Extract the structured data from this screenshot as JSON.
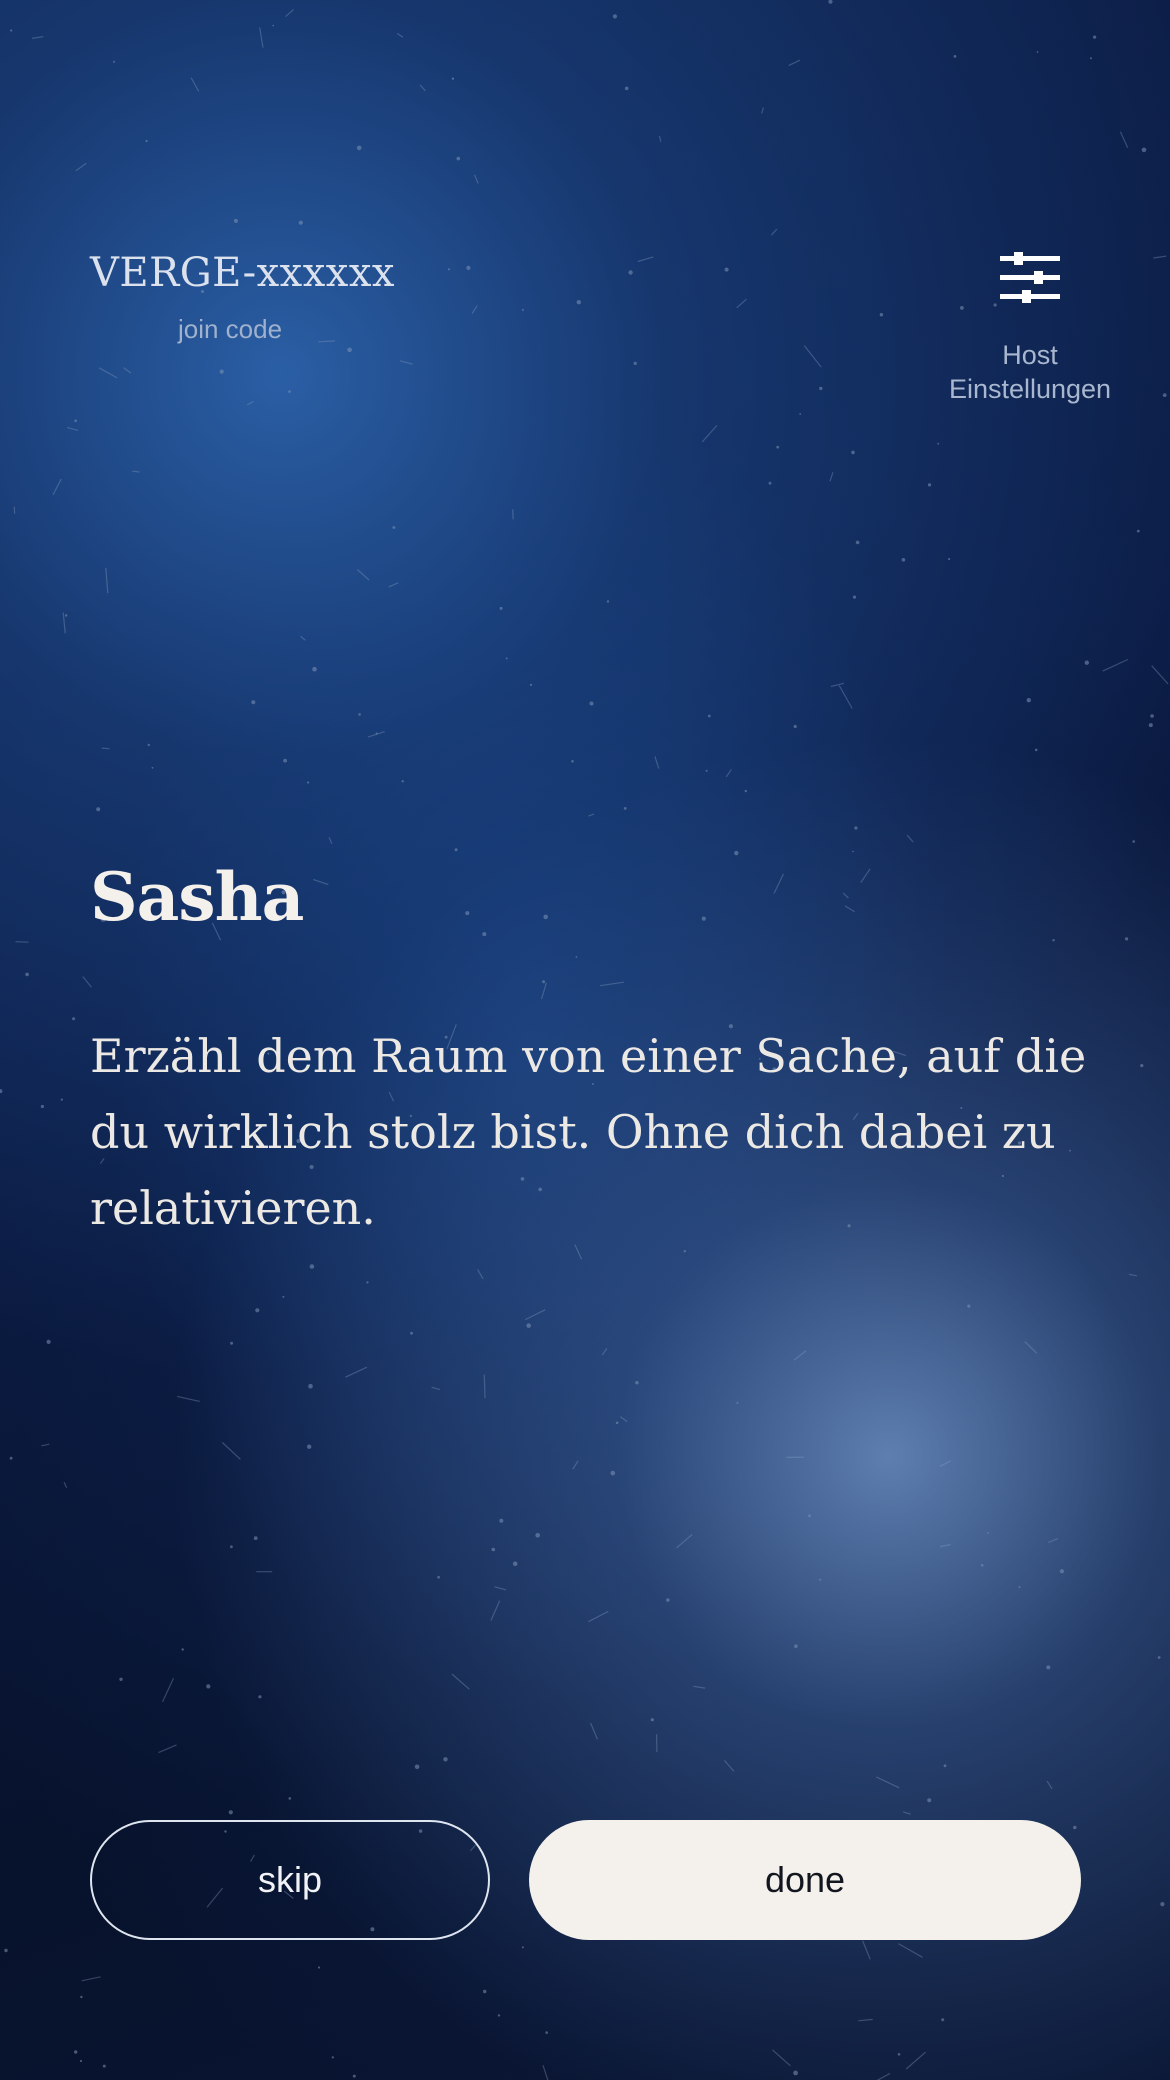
{
  "header": {
    "join_code": "VERGE-xxxxxx",
    "join_code_label": "join code",
    "settings_label_line1": "Host",
    "settings_label_line2": "Einstellungen",
    "settings_icon": "sliders-icon"
  },
  "card": {
    "player_name": "Sasha",
    "prompt": "Erzähl dem Raum von einer Sache, auf die du wirklich stolz bist. Ohne dich dabei zu relativieren."
  },
  "actions": {
    "skip_label": "skip",
    "done_label": "done"
  },
  "colors": {
    "accent_light": "#f4f1ec",
    "background_deep": "#07112a",
    "glow_blue": "#2c62aa"
  }
}
